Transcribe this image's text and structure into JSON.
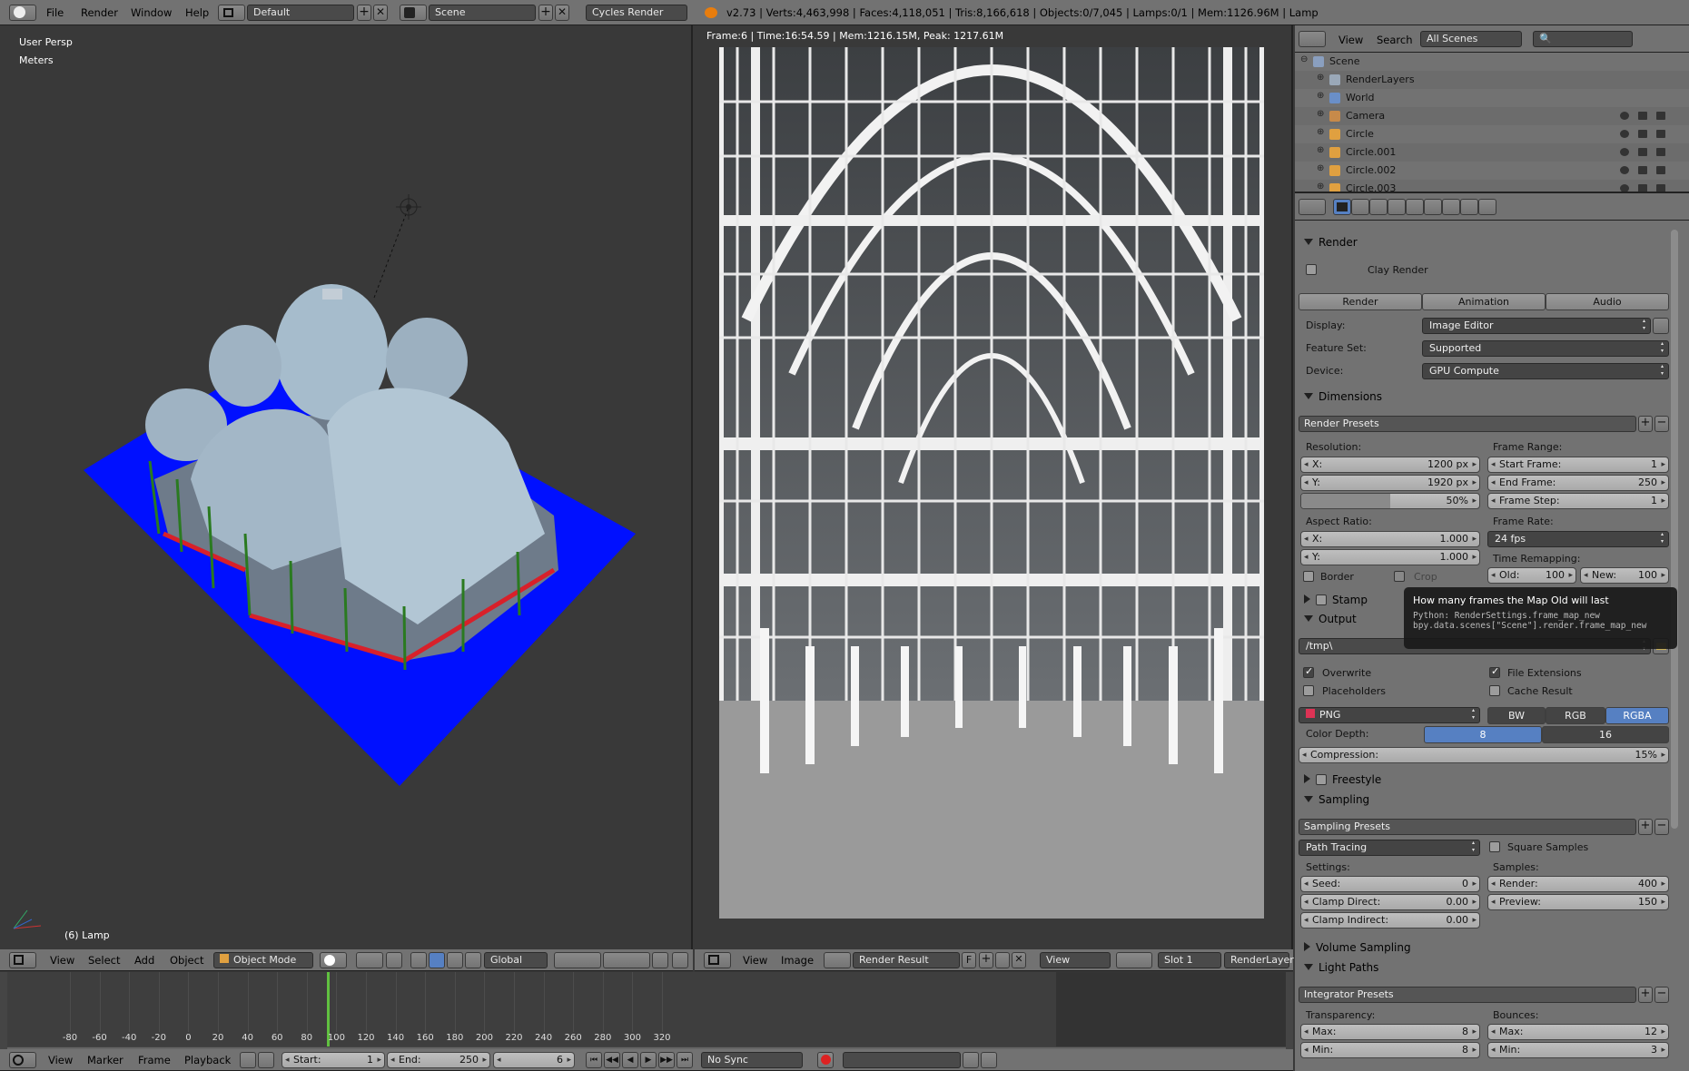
{
  "top_bar": {
    "menus": [
      "File",
      "Render",
      "Window",
      "Help"
    ],
    "screen_layout": "Default",
    "scene": "Scene",
    "engine": "Cycles Render",
    "stats": "v2.73 | Verts:4,463,998 | Faces:4,118,051 | Tris:8,166,618 | Objects:0/7,045 | Lamps:0/1 | Mem:1126.96M | Lamp"
  },
  "viewport": {
    "view_name": "User Persp",
    "units": "Meters",
    "active_object": "(6) Lamp",
    "header": {
      "menus": [
        "View",
        "Select",
        "Add",
        "Object"
      ],
      "mode": "Object Mode",
      "orientation": "Global"
    }
  },
  "image_editor": {
    "render_info": "Frame:6 | Time:16:54.59 | Mem:1216.15M, Peak: 1217.61M",
    "header": {
      "menus": [
        "View",
        "Image"
      ],
      "image": "Render Result",
      "fake_user": "F",
      "view": "View",
      "slot": "Slot 1",
      "layer": "RenderLayer"
    }
  },
  "outliner": {
    "menus": [
      "View",
      "Search"
    ],
    "filter": "All Scenes",
    "items": [
      {
        "name": "Scene",
        "indent": 0
      },
      {
        "name": "RenderLayers",
        "indent": 1
      },
      {
        "name": "World",
        "indent": 1
      },
      {
        "name": "Camera",
        "indent": 1
      },
      {
        "name": "Circle",
        "indent": 1
      },
      {
        "name": "Circle.001",
        "indent": 1
      },
      {
        "name": "Circle.002",
        "indent": 1
      },
      {
        "name": "Circle.003",
        "indent": 1
      }
    ]
  },
  "properties": {
    "render": {
      "title": "Render",
      "clay_render": "Clay Render",
      "buttons": [
        "Render",
        "Animation",
        "Audio"
      ],
      "display_label": "Display:",
      "display": "Image Editor",
      "feature_label": "Feature Set:",
      "feature": "Supported",
      "device_label": "Device:",
      "device": "GPU Compute"
    },
    "dimensions": {
      "title": "Dimensions",
      "presets": "Render Presets",
      "resolution_label": "Resolution:",
      "res_x_label": "X:",
      "res_x": "1200 px",
      "res_y_label": "Y:",
      "res_y": "1920 px",
      "res_pct": "50%",
      "res_pct_value": 0.5,
      "frame_range_label": "Frame Range:",
      "start_label": "Start Frame:",
      "start": "1",
      "end_label": "End Frame:",
      "end": "250",
      "step_label": "Frame Step:",
      "step": "1",
      "aspect_label": "Aspect Ratio:",
      "asp_x_label": "X:",
      "asp_x": "1.000",
      "asp_y_label": "Y:",
      "asp_y": "1.000",
      "frame_rate_label": "Frame Rate:",
      "frame_rate": "24 fps",
      "border": "Border",
      "crop": "Crop",
      "time_remap_label": "Time Remapping:",
      "old_label": "Old:",
      "old": "100",
      "new_label": "New:",
      "new": "100"
    },
    "stamp": {
      "title": "Stamp"
    },
    "tooltip": {
      "title": "How many frames the Map Old will last",
      "line1": "Python: RenderSettings.frame_map_new",
      "line2": "bpy.data.scenes[\"Scene\"].render.frame_map_new"
    },
    "output": {
      "title": "Output",
      "path": "/tmp\\",
      "overwrite": "Overwrite",
      "file_ext": "File Extensions",
      "placeholders": "Placeholders",
      "cache": "Cache Result",
      "format": "PNG",
      "bw": "BW",
      "rgb": "RGB",
      "rgba": "RGBA",
      "depth_label": "Color Depth:",
      "depth8": "8",
      "depth16": "16",
      "compression_label": "Compression:",
      "compression": "15%"
    },
    "freestyle": {
      "title": "Freestyle"
    },
    "sampling": {
      "title": "Sampling",
      "presets": "Sampling Presets",
      "method": "Path Tracing",
      "square": "Square Samples",
      "settings_label": "Settings:",
      "seed_label": "Seed:",
      "seed": "0",
      "clamp_d_label": "Clamp Direct:",
      "clamp_d": "0.00",
      "clamp_i_label": "Clamp Indirect:",
      "clamp_i": "0.00",
      "samples_label": "Samples:",
      "render_label": "Render:",
      "render": "400",
      "preview_label": "Preview:",
      "preview": "150"
    },
    "volume": {
      "title": "Volume Sampling"
    },
    "light_paths": {
      "title": "Light Paths",
      "presets": "Integrator Presets",
      "transparency_label": "Transparency:",
      "bounces_label": "Bounces:",
      "max_label": "Max:",
      "t_max": "8",
      "b_max": "12",
      "min_label": "Min:",
      "t_min": "8",
      "b_min": "3"
    }
  },
  "timeline": {
    "ruler": [
      "-80",
      "-60",
      "-40",
      "-20",
      "0",
      "20",
      "40",
      "60",
      "80",
      "100",
      "120",
      "140",
      "160",
      "180",
      "200",
      "220",
      "240",
      "260",
      "280",
      "300",
      "320"
    ],
    "menus": [
      "View",
      "Marker",
      "Frame",
      "Playback"
    ],
    "start_label": "Start:",
    "start": "1",
    "end_label": "End:",
    "end": "250",
    "current": "6",
    "sync": "No Sync"
  },
  "colors": {
    "accent": "#5680c2",
    "ground": "#0010ff",
    "bg": "#393939",
    "header": "#727272"
  }
}
